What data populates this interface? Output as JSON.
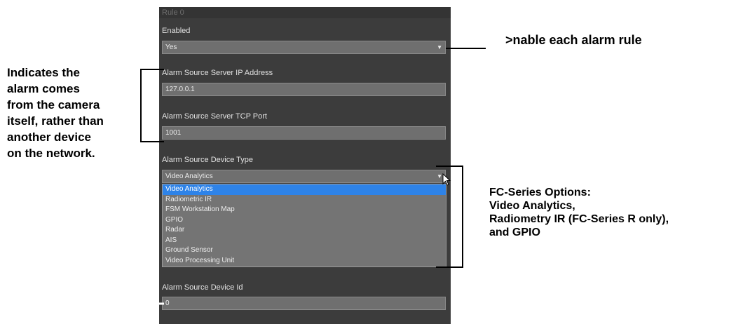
{
  "panel": {
    "header": "Rule 0",
    "enabled": {
      "label": "Enabled",
      "value": "Yes"
    },
    "ip": {
      "label": "Alarm Source Server IP Address",
      "value": "127.0.0.1"
    },
    "port": {
      "label": "Alarm Source Server TCP Port",
      "value": "1001"
    },
    "device_type": {
      "label": "Alarm Source Device Type",
      "value": "Video Analytics",
      "options": [
        "Video Analytics",
        "Radiometric IR",
        "FSM Workstation Map",
        "GPIO",
        "Radar",
        "AIS",
        "Ground Sensor",
        "Video Processing Unit"
      ],
      "selected_option": "Video Analytics"
    },
    "device_id": {
      "label": "Alarm Source Device Id",
      "value": "0"
    }
  },
  "annotations": {
    "right_top": ">nable each alarm rule",
    "left": [
      "Indicates the",
      "alarm comes",
      "from the camera",
      "itself, rather than",
      "another device",
      "on the network."
    ],
    "right_bottom": [
      "FC-Series Options:",
      "Video Analytics,",
      "Radiometry IR (FC-Series R only),",
      "and GPIO"
    ]
  },
  "colors": {
    "selection": "#2e83e8",
    "panel_bg": "#3c3c3c"
  }
}
